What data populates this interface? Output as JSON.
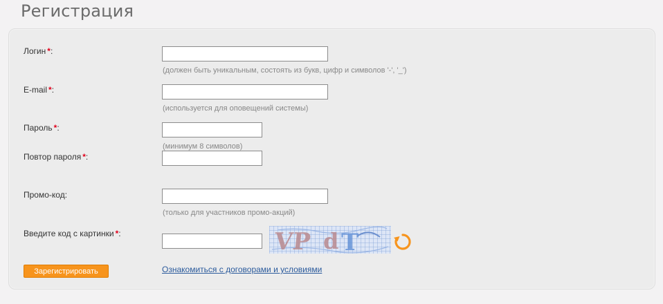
{
  "page": {
    "title": "Регистрация"
  },
  "form": {
    "required_mark": "*",
    "colon": ":",
    "login": {
      "label": "Логин",
      "value": "",
      "hint": "(должен быть уникальным, состоять из букв, цифр и символов '-', '_')"
    },
    "email": {
      "label": "E-mail",
      "value": "",
      "hint": "(используется для оповещений системы)"
    },
    "password": {
      "label": "Пароль",
      "value": "",
      "hint": "(минимум 8 символов)"
    },
    "password_repeat": {
      "label": "Повтор пароля",
      "value": ""
    },
    "promo": {
      "label": "Промо-код:",
      "value": "",
      "hint": "(только для участников промо-акций)"
    },
    "captcha": {
      "label": "Введите код с картинки",
      "value": "",
      "image_text": "VPdT",
      "refresh_icon": "refresh-icon"
    },
    "submit_label": "Зарегистрировать",
    "terms_link": "Ознакомиться с договорами и условиями"
  },
  "colors": {
    "accent": "#f7941d",
    "required": "#e0001b",
    "link": "#2a5a9c",
    "panel": "#ececec"
  }
}
